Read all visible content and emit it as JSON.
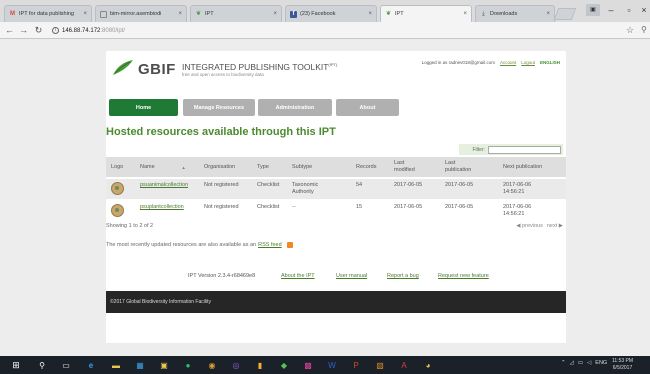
{
  "browser": {
    "tabs": [
      {
        "label": "IPT for data publishing",
        "icon": "gmail-icon",
        "active": false
      },
      {
        "label": "bim-mirror.asembiodi",
        "icon": "page-icon",
        "active": false
      },
      {
        "label": "IPT",
        "icon": "ipt-leaf-icon",
        "active": false
      },
      {
        "label": "(23) Facebook",
        "icon": "facebook-icon",
        "active": false
      },
      {
        "label": "IPT",
        "icon": "ipt-leaf-icon",
        "active": true
      },
      {
        "label": "Downloads",
        "icon": "download-icon",
        "active": false
      }
    ],
    "url_host": "146.88.74.172",
    "url_path": ":8080/ipt/"
  },
  "header": {
    "logo_text": "GBIF",
    "tool_title": "INTEGRATED PUBLISHING TOOLKIT",
    "tool_title_sup": "(IPT)",
    "tagline": "free and open access to biodiversity data",
    "logged_in_text": "Logged in as radnev018@gmail.com",
    "account_label": "Account",
    "logout_label": "Logout",
    "language_label": "ENGLISH"
  },
  "nav": {
    "home": "Home",
    "manage": "Manage Resources",
    "admin": "Administration",
    "about": "About"
  },
  "page_title": "Hosted resources available through this IPT",
  "filter": {
    "label": "Filter:",
    "value": ""
  },
  "table": {
    "headers": {
      "logo": "Logo",
      "name": "Name",
      "sort_glyph": "▲",
      "organisation": "Organisation",
      "type": "Type",
      "subtype": "Subtype",
      "records": "Records",
      "last_modified_1": "Last",
      "last_modified_2": "modified",
      "last_publication_1": "Last",
      "last_publication_2": "publication",
      "next_publication": "Next publication"
    },
    "rows": [
      {
        "name": "psuanimalcollection",
        "organisation": "Not registered",
        "type": "Checklist",
        "subtype_1": "Taxonomic",
        "subtype_2": "Authority",
        "records": "54",
        "last_modified": "2017-06-05",
        "last_publication": "2017-06-05",
        "next_pub_date": "2017-06-06",
        "next_pub_time": "14:56:21"
      },
      {
        "name": "psuplantcollection",
        "organisation": "Not registered",
        "type": "Checklist",
        "subtype_1": "--",
        "subtype_2": "",
        "records": "15",
        "last_modified": "2017-06-05",
        "last_publication": "2017-06-05",
        "next_pub_date": "2017-06-06",
        "next_pub_time": "14:56:21"
      }
    ]
  },
  "showing_text": "Showing 1 to 2 of 2",
  "pager": {
    "previous": "◀ previous",
    "next": "next ▶"
  },
  "recent_note": {
    "before": "The most recently updated resources are also available as an",
    "link": "RSS feed"
  },
  "footer": {
    "version": "IPT Version 2.3.4-r68469e8",
    "about": "About the IPT",
    "manual": "User manual",
    "bug": "Report a bug",
    "feature": "Request new feature",
    "copyright": "©2017 Global Biodiversity Information Facility"
  },
  "taskbar": {
    "lang": "ENG",
    "time": "11:53 PM",
    "date": "6/5/2017"
  },
  "colors": {
    "accent_green": "#1e7a34",
    "title_green": "#4b8a2f",
    "footer_dark": "#262626"
  }
}
